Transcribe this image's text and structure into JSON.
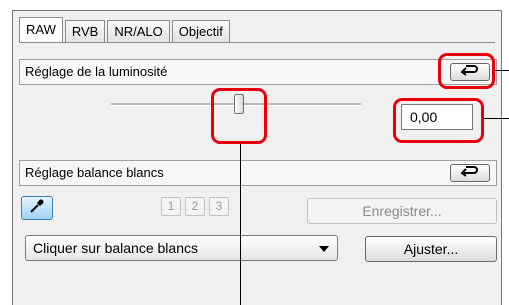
{
  "tabs": [
    {
      "label": "RAW",
      "active": true
    },
    {
      "label": "RVB",
      "active": false
    },
    {
      "label": "NR/ALO",
      "active": false
    },
    {
      "label": "Objectif",
      "active": false
    }
  ],
  "brightness": {
    "title": "Réglage de la luminosité",
    "reset_icon": "undo-arrow-icon",
    "value": "0,00",
    "slider_level": 0.5
  },
  "white_balance": {
    "title": "Réglage balance blancs",
    "reset_icon": "undo-arrow-icon",
    "eyedropper_icon": "eyedropper-icon",
    "presets": [
      "1",
      "2",
      "3"
    ],
    "save_label": "Enregistrer...",
    "select_value": "Cliquer sur balance blancs",
    "adjust_label": "Ajuster..."
  },
  "colors": {
    "highlight": "#e8000b",
    "eyedropper_bg": "#9fd2f4"
  }
}
